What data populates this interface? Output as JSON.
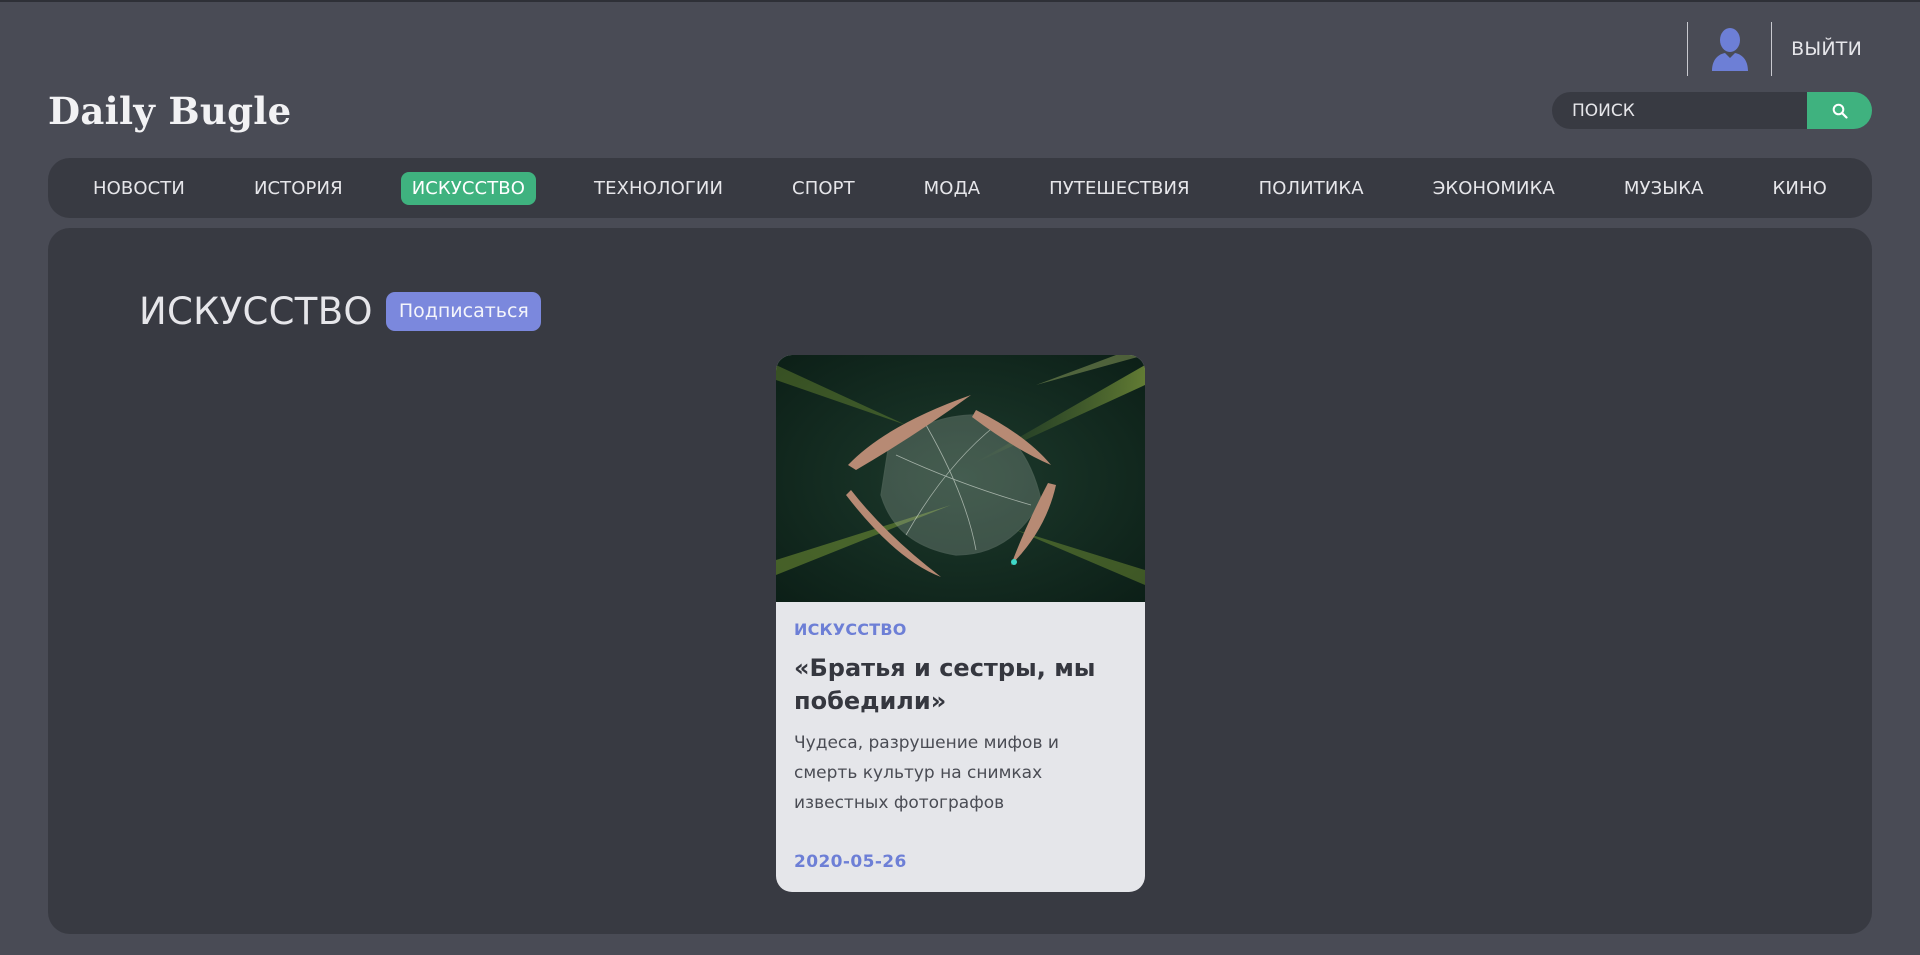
{
  "header": {
    "logo": "Daily Bugle",
    "logout_label": "ВЫЙТИ",
    "user_icon": "user-avatar-icon",
    "search": {
      "placeholder": "ПОИСК",
      "button_icon": "search-icon"
    }
  },
  "nav": {
    "items": [
      {
        "label": "НОВОСТИ"
      },
      {
        "label": "ИСТОРИЯ"
      },
      {
        "label": "ИСКУССТВО",
        "active": true
      },
      {
        "label": "ТЕХНОЛОГИИ"
      },
      {
        "label": "СПОРТ"
      },
      {
        "label": "МОДА"
      },
      {
        "label": "ПУТЕШЕСТВИЯ"
      },
      {
        "label": "ПОЛИТИКА"
      },
      {
        "label": "ЭКОНОМИКА"
      },
      {
        "label": "МУЗЫКА"
      },
      {
        "label": "КИНО"
      }
    ]
  },
  "section": {
    "title": "ИСКУССТВО",
    "subscribe_label": "Подписаться"
  },
  "articles": [
    {
      "category": "ИСКУССТВО",
      "title": "«Братья и сестры, мы победили»",
      "description": "Чудеса, разрушение мифов и смерть культур на снимках известных фотографов",
      "date": "2020-05-26"
    }
  ],
  "colors": {
    "background": "#494b55",
    "panel": "#383a42",
    "accent_green": "#3fb27f",
    "accent_blue": "#7b88dd",
    "card": "#e5e6ea"
  }
}
